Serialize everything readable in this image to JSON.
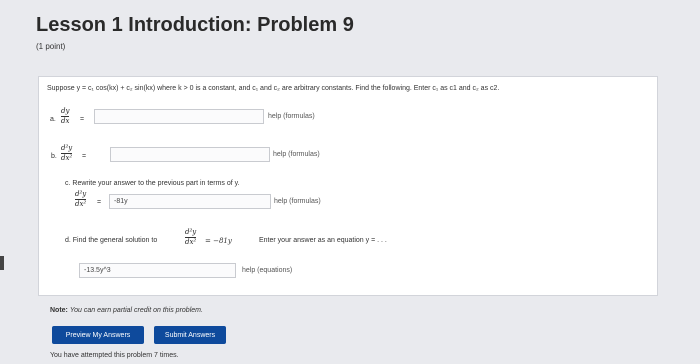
{
  "header": {
    "title": "Lesson 1 Introduction: Problem 9",
    "points": "(1 point)"
  },
  "problem": {
    "statement": "Suppose y = c₁ cos(kx) + c₂ sin(kx) where k > 0 is a constant, and c₁ and c₂ are arbitrary constants. Find the following. Enter c₁ as c1 and c₂ as c2.",
    "parts": {
      "a": {
        "label": "a.",
        "num": "dy",
        "den": "dx",
        "eq": "=",
        "value": "",
        "help": "help (formulas)"
      },
      "b": {
        "label": "b.",
        "num": "d²y",
        "den": "dx²",
        "eq": "=",
        "value": "",
        "help": "help (formulas)"
      },
      "c": {
        "intro": "c. Rewrite your answer to the previous part in terms of y.",
        "num": "d²y",
        "den": "dx²",
        "eq": "=",
        "value": "-81y",
        "help": "help (formulas)"
      },
      "d": {
        "text_pre": "d. Find the general solution to",
        "num": "d²y",
        "den": "dx²",
        "text_eq": "= −81y",
        "text_post": "Enter your answer as an equation y = . . .",
        "value": "-13.5y^3",
        "help": "help (equations)"
      }
    }
  },
  "note": {
    "label": "Note:",
    "text": "You can earn partial credit on this problem."
  },
  "buttons": {
    "preview": "Preview My Answers",
    "submit": "Submit Answers"
  },
  "attempts": "You have attempted this problem 7 times."
}
